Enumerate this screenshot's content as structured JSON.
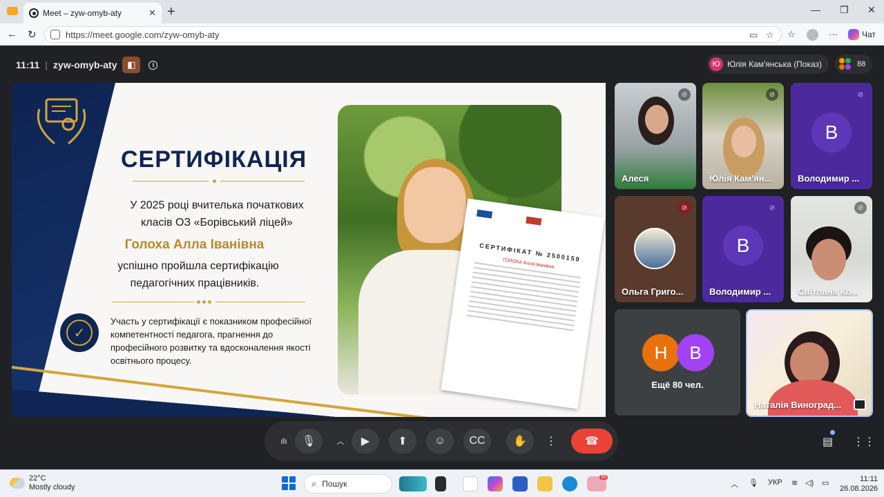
{
  "browser": {
    "tab_title": "Meet – zyw-omyb-aty",
    "url": "https://meet.google.com/zyw-omyb-aty",
    "copilot_label": "Чат"
  },
  "meet": {
    "time": "11:11",
    "code": "zyw-omyb-aty",
    "presenter_initial": "Ю",
    "presenter_label": "Юлія Кам'янська (Показ)",
    "participant_count": "88",
    "more_label": "Ещё 80 чел.",
    "more_initials": [
      "Н",
      "В"
    ]
  },
  "slide": {
    "title": "СЕРТИФІКАЦІЯ",
    "line1": "У 2025 році вчителька початкових",
    "line2": "класів ОЗ «Борівський ліцей»",
    "name": "Голоха Алла Іванівна",
    "line3": "успішно пройшла сертифікацію",
    "line4": "педагогічних працівників.",
    "note": "Участь у сертифікації є показником професійної компетентності педагога, прагнення до професійного розвитку та вдосконалення якості освітнього процесу.",
    "paper_heading": "СЕРТИФІКАТ № 2500159",
    "paper_name": "ГОЛОХА Алла Іванівна"
  },
  "tiles": [
    {
      "name": "Алеся",
      "type": "video"
    },
    {
      "name": "Юлія Кам'ян...",
      "type": "video"
    },
    {
      "name": "Володимир ...",
      "type": "letter",
      "initial": "В"
    },
    {
      "name": "Ольга Григо...",
      "type": "avatar"
    },
    {
      "name": "Володимир ...",
      "type": "letter",
      "initial": "В"
    },
    {
      "name": "Світлана Ко...",
      "type": "video"
    },
    {
      "name": "Наталія Виноград...",
      "type": "video"
    }
  ],
  "taskbar": {
    "temp": "22°C",
    "weather": "Mostly cloudy",
    "search": "Пошук",
    "lang": "УКР",
    "time": "11:11",
    "date": "26.08.2026",
    "badge_count": "99"
  },
  "colors": {
    "meet_bg": "#202124",
    "end_call": "#ea4335",
    "navy": "#0f2553",
    "gold": "#c9a24c",
    "purple_tile": "#4c2a9e"
  }
}
